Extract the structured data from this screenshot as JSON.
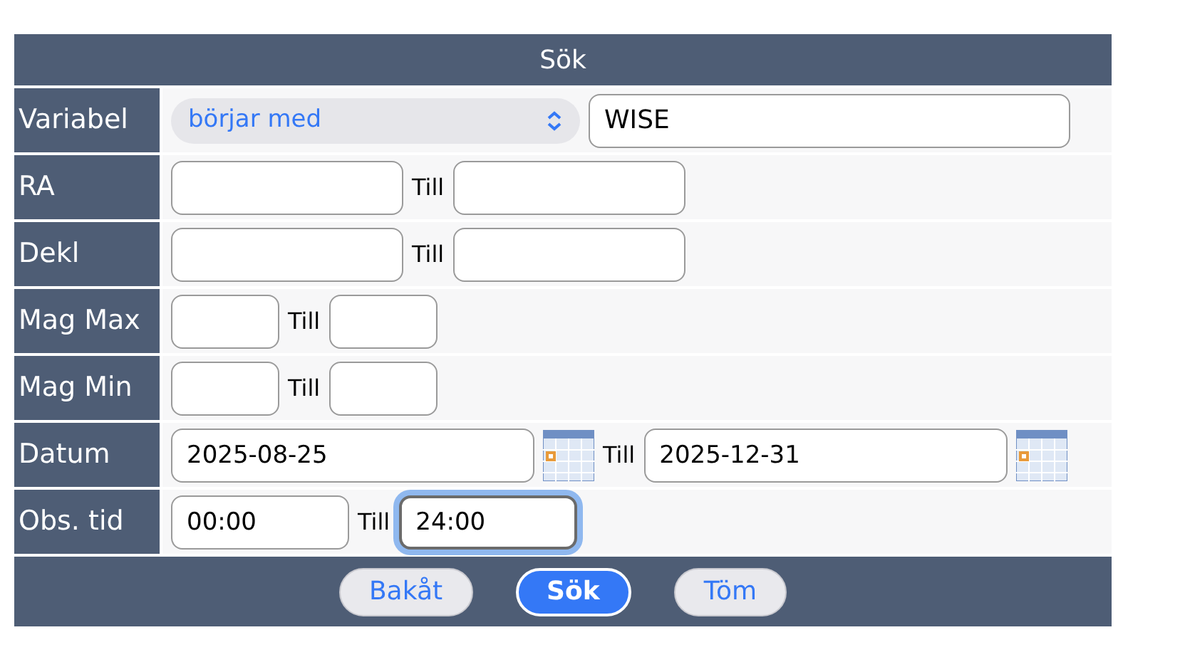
{
  "title": "Sök",
  "rows": [
    {
      "kind": "select",
      "label": "Variabel",
      "select": "börjar med",
      "value": "WISE"
    },
    {
      "kind": "range",
      "label": "RA",
      "separator": "Till",
      "from": {
        "focused": false
      },
      "to": {
        "focused": false
      }
    },
    {
      "kind": "range",
      "label": "Dekl",
      "separator": "Till",
      "from": {
        "focused": false
      },
      "to": {
        "focused": false
      }
    },
    {
      "kind": "short",
      "label": "Mag Max",
      "separator": "Till",
      "from": {
        "focused": false
      },
      "to": {
        "focused": false
      }
    },
    {
      "kind": "short",
      "label": "Mag Min",
      "separator": "Till",
      "from": {
        "focused": false
      },
      "to": {
        "focused": false
      }
    },
    {
      "kind": "date",
      "label": "Datum",
      "separator": "Till",
      "from": {
        "value": "2025-08-25",
        "focused": false
      },
      "to": {
        "value": "2025-12-31",
        "focused": false
      }
    },
    {
      "kind": "time",
      "label": "Obs. tid",
      "separator": "Till",
      "from": {
        "value": "00:00",
        "focused": false
      },
      "to": {
        "value": "24:00",
        "focused": true
      }
    }
  ],
  "buttons": [
    {
      "label": "Bakåt",
      "primary": false
    },
    {
      "label": "Sök",
      "primary": true
    },
    {
      "label": "Töm",
      "primary": false
    }
  ]
}
